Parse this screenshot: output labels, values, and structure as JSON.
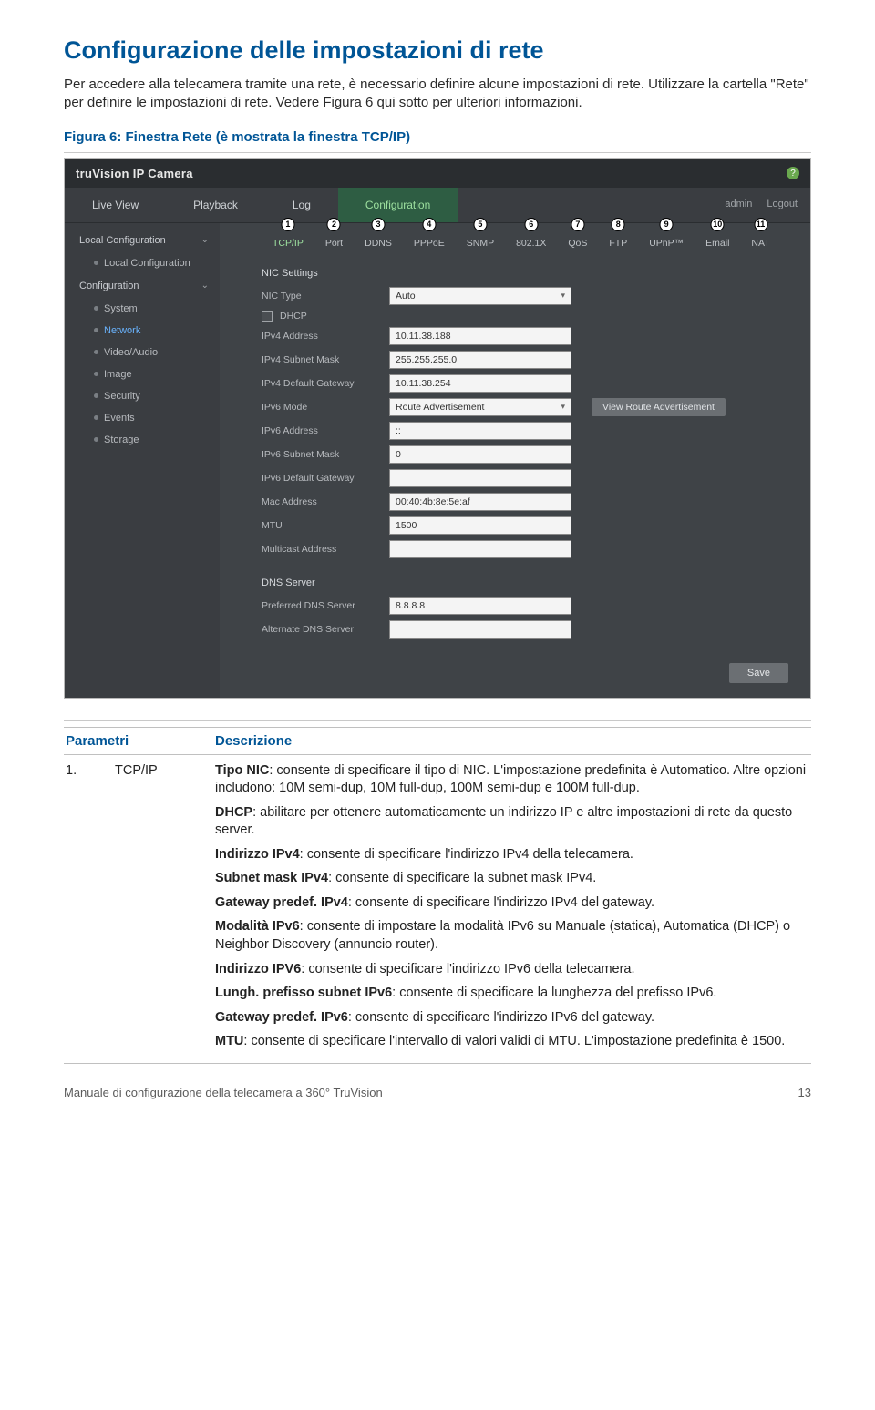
{
  "heading": "Configurazione delle impostazioni di rete",
  "intro": "Per accedere alla telecamera tramite una rete, è necessario definire alcune impostazioni di rete. Utilizzare la cartella \"Rete\" per definire le impostazioni di rete. Vedere Figura 6 qui sotto per ulteriori informazioni.",
  "figcap": "Figura 6: Finestra Rete (è mostrata la finestra TCP/IP)",
  "shot": {
    "brand": "truVision  IP Camera",
    "help": "?",
    "topnav": {
      "liveview": "Live View",
      "playback": "Playback",
      "log": "Log",
      "config": "Configuration",
      "admin": "admin",
      "logout": "Logout"
    },
    "sidebar": {
      "localconf_group": "Local Configuration",
      "localconf_item": "Local Configuration",
      "config_group": "Configuration",
      "items": {
        "system": "System",
        "network": "Network",
        "videoaudio": "Video/Audio",
        "image": "Image",
        "security": "Security",
        "events": "Events",
        "storage": "Storage"
      }
    },
    "subtabs": [
      "TCP/IP",
      "Port",
      "DDNS",
      "PPPoE",
      "SNMP",
      "802.1X",
      "QoS",
      "FTP",
      "UPnP™",
      "Email",
      "NAT"
    ],
    "nic_section": "NIC Settings",
    "fields": {
      "nictype_lbl": "NIC Type",
      "nictype_val": "Auto",
      "dhcp_lbl": "DHCP",
      "v4addr_lbl": "IPv4 Address",
      "v4addr_val": "10.11.38.188",
      "v4mask_lbl": "IPv4 Subnet Mask",
      "v4mask_val": "255.255.255.0",
      "v4gw_lbl": "IPv4 Default Gateway",
      "v4gw_val": "10.11.38.254",
      "v6mode_lbl": "IPv6 Mode",
      "v6mode_val": "Route Advertisement",
      "v6route_btn": "View Route Advertisement",
      "v6addr_lbl": "IPv6 Address",
      "v6addr_val": "::",
      "v6mask_lbl": "IPv6 Subnet Mask",
      "v6mask_val": "0",
      "v6gw_lbl": "IPv6 Default Gateway",
      "v6gw_val": "",
      "mac_lbl": "Mac Address",
      "mac_val": "00:40:4b:8e:5e:af",
      "mtu_lbl": "MTU",
      "mtu_val": "1500",
      "multi_lbl": "Multicast Address",
      "multi_val": ""
    },
    "dns_section": "DNS Server",
    "dns": {
      "pref_lbl": "Preferred DNS Server",
      "pref_val": "8.8.8.8",
      "alt_lbl": "Alternate DNS Server",
      "alt_val": ""
    },
    "save": "Save"
  },
  "table": {
    "hdr_param": "Parametri",
    "hdr_desc": "Descrizione",
    "r1_idx": "1.",
    "r1_name": "TCP/IP",
    "r1_p1a": "Tipo NIC",
    "r1_p1b": ": consente di specificare il tipo di NIC. L'impostazione predefinita è Automatico. Altre opzioni includono: 10M semi-dup, 10M full-dup, 100M semi-dup e 100M full-dup.",
    "r1_p2a": "DHCP",
    "r1_p2b": ": abilitare per ottenere automaticamente un indirizzo IP e altre impostazioni di rete da questo server.",
    "r1_p3a": "Indirizzo IPv4",
    "r1_p3b": ": consente di specificare l'indirizzo IPv4 della telecamera.",
    "r1_p4a": "Subnet mask IPv4",
    "r1_p4b": ": consente di specificare la subnet mask IPv4.",
    "r1_p5a": "Gateway predef. IPv4",
    "r1_p5b": ": consente di specificare l'indirizzo IPv4 del gateway.",
    "r1_p6a": "Modalità IPv6",
    "r1_p6b": ": consente di impostare la modalità IPv6 su Manuale (statica), Automatica (DHCP) o Neighbor Discovery (annuncio router).",
    "r1_p7a": "Indirizzo IPV6",
    "r1_p7b": ": consente di specificare l'indirizzo IPv6 della telecamera.",
    "r1_p8a": "Lungh. prefisso subnet IPv6",
    "r1_p8b": ": consente di specificare la lunghezza del prefisso IPv6.",
    "r1_p9a": "Gateway predef. IPv6",
    "r1_p9b": ": consente di specificare l'indirizzo IPv6 del gateway.",
    "r1_p10a": "MTU",
    "r1_p10b": ": consente di specificare l'intervallo di valori validi di MTU. L'impostazione predefinita è 1500."
  },
  "footer": {
    "manual": "Manuale di configurazione della telecamera a 360° TruVision",
    "page": "13"
  }
}
